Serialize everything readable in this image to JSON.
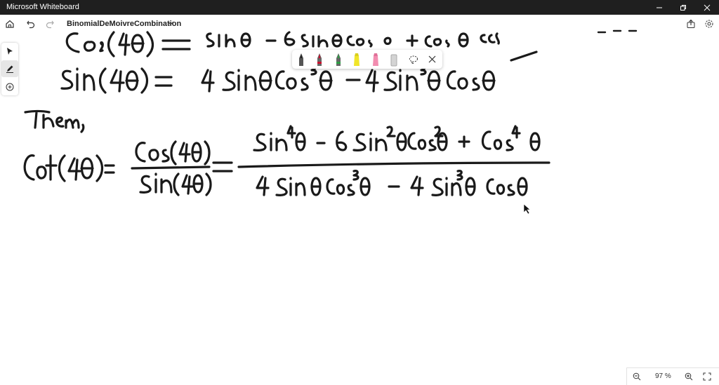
{
  "window": {
    "title": "Microsoft Whiteboard"
  },
  "toolbar": {
    "board_name": "BinomialDeMoivreCombination"
  },
  "tools": [
    "select-tool",
    "pen-tool",
    "add-tool"
  ],
  "pens": [
    {
      "name": "pen-black",
      "color": "#222222"
    },
    {
      "name": "pen-red",
      "color": "#c8102e"
    },
    {
      "name": "pen-green",
      "color": "#2e9e44"
    },
    {
      "name": "highlighter-yellow",
      "color": "#f0e52a"
    },
    {
      "name": "highlighter-pink",
      "color": "#f28db0"
    },
    {
      "name": "eraser",
      "color": "#c8c8c8"
    }
  ],
  "zoom": {
    "level": "97 %"
  }
}
